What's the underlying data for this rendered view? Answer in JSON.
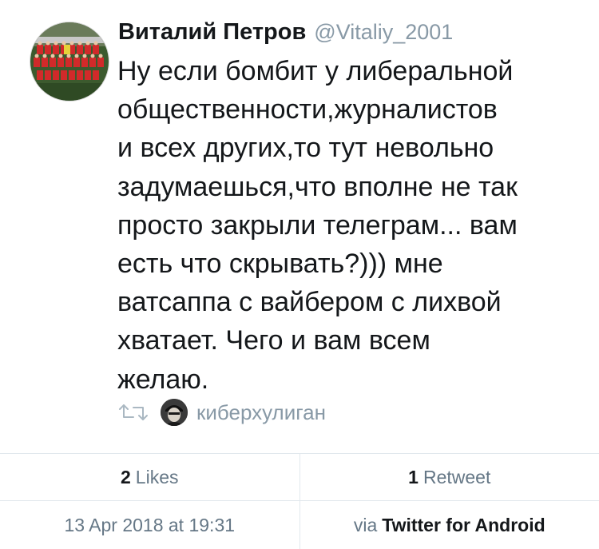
{
  "tweet": {
    "author": {
      "display_name": "Виталий Петров",
      "handle": "@Vitaliy_2001",
      "avatar": "team-photo-avatar"
    },
    "text": "Ну если бомбит у либеральной\nобщественности,журналистов\nи всех других,то тут невольно\nзадумаешься,что вполне не так\nпросто закрыли телеграм... вам\nесть что скрывать?))) мне\nватсаппа с вайбером с лихвой\nхватает. Чего и вам всем\nжелаю.",
    "retweeted_by": {
      "icon": "retweet-icon",
      "name": "киберхулиган"
    }
  },
  "stats": {
    "likes_count": "2",
    "likes_label": "Likes",
    "retweets_count": "1",
    "retweets_label": "Retweet"
  },
  "meta": {
    "timestamp": "13 Apr 2018 at 19:31",
    "via_label": "via",
    "source_app": "Twitter for Android"
  },
  "colors": {
    "text": "#14171a",
    "secondary": "#8899a6",
    "divider": "#e1e8ed"
  }
}
